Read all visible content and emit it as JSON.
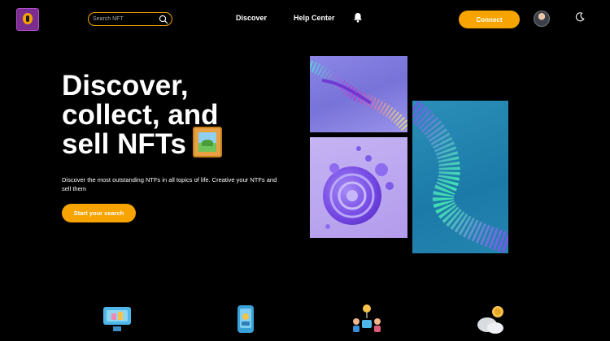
{
  "header": {
    "search_placeholder": "Search NFT",
    "nav": [
      "Discover",
      "Help Center"
    ],
    "connect_label": "Connect"
  },
  "hero": {
    "title_lines": [
      "Discover,",
      "collect, and",
      "sell NFTs"
    ],
    "description": "Discover the most outstanding NTFs in all topics of life. Creative your NTFs and sell them",
    "cta_label": "Start your search"
  },
  "colors": {
    "accent": "#f7a400",
    "background": "#000000"
  },
  "icons": [
    "logo-icon",
    "search-icon",
    "bell-icon",
    "avatar",
    "moon-icon",
    "picture-frame-icon",
    "monitor-icon",
    "phone-icon",
    "people-icon",
    "coins-icon"
  ]
}
